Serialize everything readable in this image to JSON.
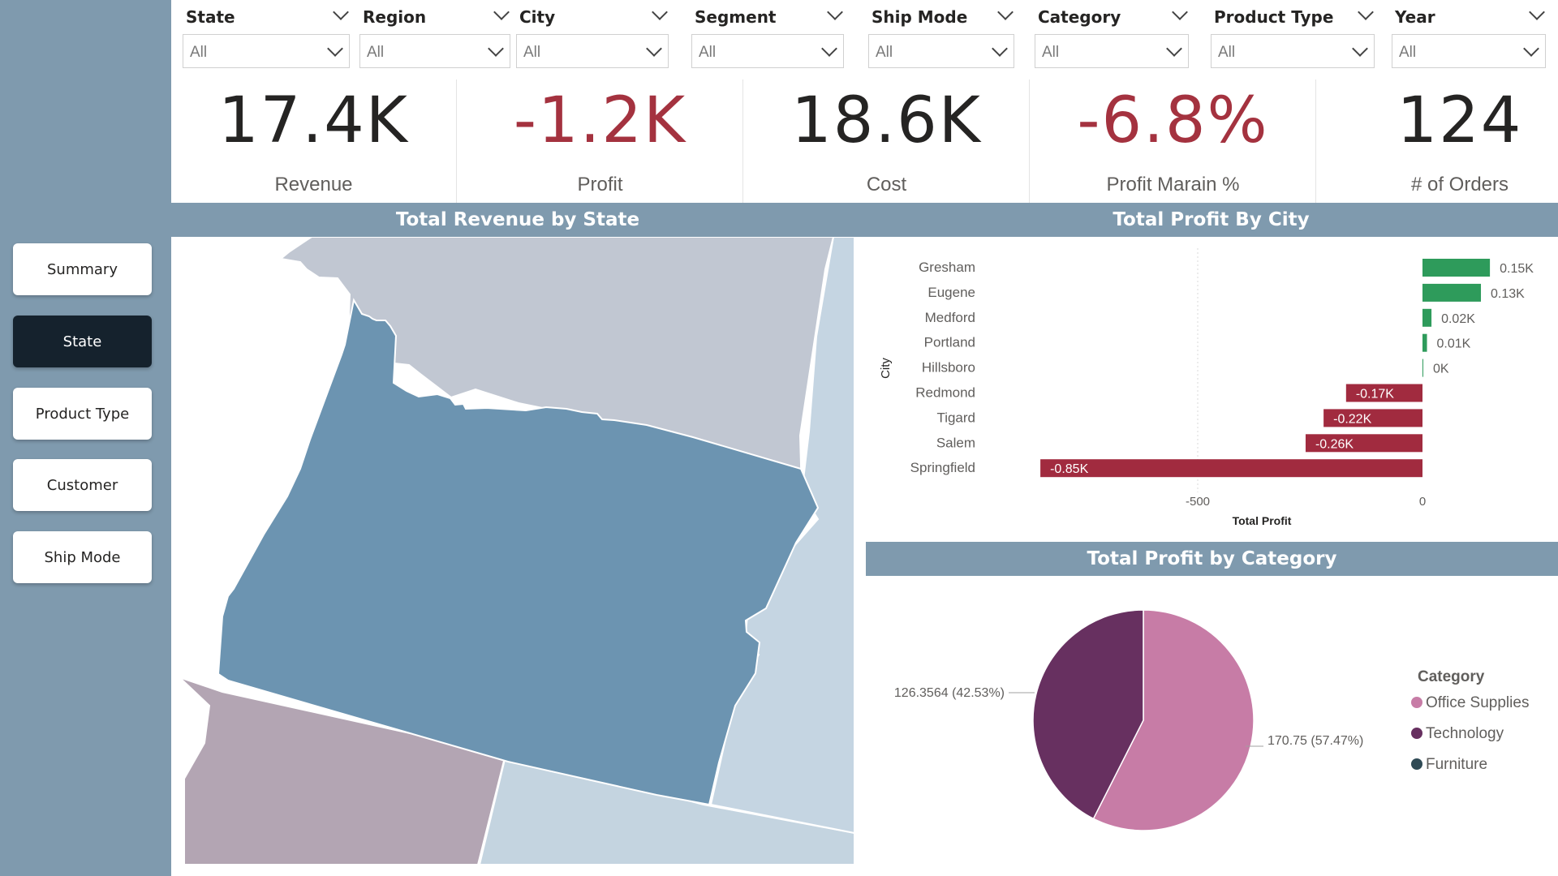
{
  "nav": [
    {
      "label": "Summary",
      "active": false
    },
    {
      "label": "State",
      "active": true
    },
    {
      "label": "Product Type",
      "active": false
    },
    {
      "label": "Customer",
      "active": false
    },
    {
      "label": "Ship Mode",
      "active": false
    }
  ],
  "filters": [
    {
      "label": "State",
      "value": "All"
    },
    {
      "label": "Region",
      "value": "All"
    },
    {
      "label": "City",
      "value": "All"
    },
    {
      "label": "Segment",
      "value": "All"
    },
    {
      "label": "Ship Mode",
      "value": "All"
    },
    {
      "label": "Category",
      "value": "All"
    },
    {
      "label": "Product Type",
      "value": "All"
    },
    {
      "label": "Year",
      "value": "All"
    }
  ],
  "kpis": [
    {
      "value": "17.4K",
      "label": "Revenue",
      "negative": false
    },
    {
      "value": "-1.2K",
      "label": "Profit",
      "negative": true
    },
    {
      "value": "18.6K",
      "label": "Cost",
      "negative": false
    },
    {
      "value": "-6.8%",
      "label": "Profit Marain %",
      "negative": true
    },
    {
      "value": "124",
      "label": "# of Orders",
      "negative": false
    }
  ],
  "map": {
    "title": "Total Revenue by State"
  },
  "colors": {
    "sidebar": "#7f9aae",
    "active_button": "#15222d",
    "negative_kpi": "#a4323f",
    "map_selected_state": "#6c94b1",
    "map_north_state": "#c1c7d2",
    "map_east_state": "#c5d5e2",
    "map_south_west_state": "#b3a5b3",
    "map_south_east_state": "#c4d4e0",
    "bar_positive": "#2e9b5b",
    "bar_negative": "#a12b3f",
    "pie_office_supplies": "#c77ca6",
    "pie_technology": "#673060",
    "pie_furniture": "#2f4a55"
  },
  "chart_data": [
    {
      "type": "bar",
      "orientation": "horizontal",
      "title": "Total Profit By City",
      "xlabel": "Total Profit",
      "ylabel": "City",
      "categories": [
        "Gresham",
        "Eugene",
        "Medford",
        "Portland",
        "Hillsboro",
        "Redmond",
        "Tigard",
        "Salem",
        "Springfield"
      ],
      "values": [
        150,
        130,
        20,
        10,
        0,
        -170,
        -220,
        -260,
        -850
      ],
      "data_labels": [
        "0.15K",
        "0.13K",
        "0.02K",
        "0.01K",
        "0K",
        "-0.17K",
        "-0.22K",
        "-0.26K",
        "-0.85K"
      ],
      "xticks": [
        -500,
        0
      ],
      "xlim": [
        -850,
        150
      ]
    },
    {
      "type": "pie",
      "title": "Total Profit by Category",
      "legend_title": "Category",
      "categories": [
        "Office Supplies",
        "Technology",
        "Furniture"
      ],
      "values": [
        170.75,
        126.3564,
        0
      ],
      "data_labels": [
        "170.75 (57.47%)",
        "126.3564 (42.53%)",
        ""
      ],
      "legend_position": "right"
    }
  ]
}
